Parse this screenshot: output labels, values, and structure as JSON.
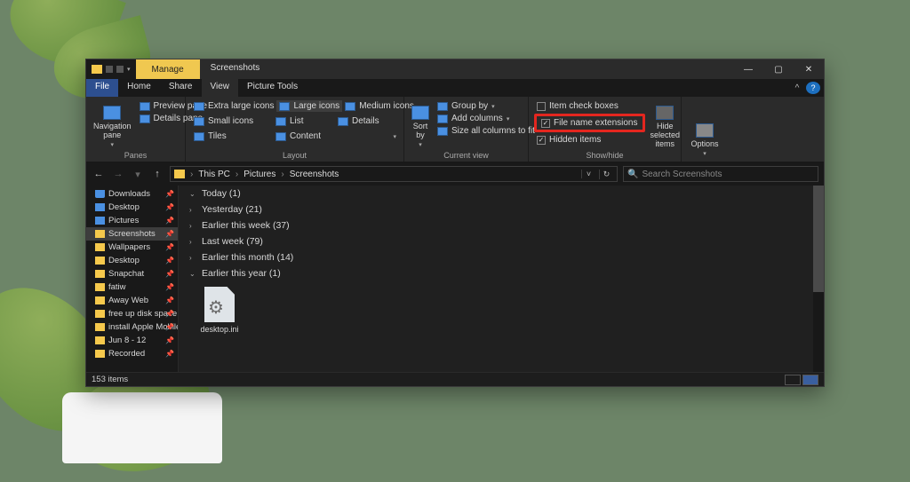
{
  "titlebar": {
    "context_tab": "Manage",
    "title": "Screenshots"
  },
  "menubar": {
    "file": "File",
    "tabs": [
      "Home",
      "Share",
      "View"
    ],
    "active_index": 2,
    "context_tool": "Picture Tools"
  },
  "ribbon": {
    "panes": {
      "label": "Panes",
      "nav": "Navigation pane",
      "preview": "Preview pane",
      "details": "Details pane"
    },
    "layout": {
      "label": "Layout",
      "items": [
        "Extra large icons",
        "Large icons",
        "Medium icons",
        "Small icons",
        "List",
        "Details",
        "Tiles",
        "Content"
      ],
      "selected_index": 1
    },
    "current_view": {
      "label": "Current view",
      "sort": "Sort by",
      "group": "Group by",
      "add_cols": "Add columns",
      "size_cols": "Size all columns to fit"
    },
    "showhide": {
      "label": "Show/hide",
      "item_check": "Item check boxes",
      "ext": "File name extensions",
      "hidden": "Hidden items",
      "hide_sel": "Hide selected items",
      "item_check_checked": false,
      "ext_checked": true,
      "hidden_checked": true
    },
    "options": "Options"
  },
  "address": {
    "crumbs": [
      "This PC",
      "Pictures",
      "Screenshots"
    ]
  },
  "search": {
    "placeholder": "Search Screenshots"
  },
  "tree": [
    {
      "label": "Downloads",
      "pinned": true,
      "kind": "dl"
    },
    {
      "label": "Desktop",
      "pinned": true,
      "kind": "blue"
    },
    {
      "label": "Pictures",
      "pinned": true,
      "kind": "blue"
    },
    {
      "label": "Screenshots",
      "pinned": true,
      "kind": "folder",
      "active": true
    },
    {
      "label": "Wallpapers",
      "pinned": true,
      "kind": "folder"
    },
    {
      "label": "Desktop",
      "pinned": true,
      "kind": "folder"
    },
    {
      "label": "Snapchat",
      "pinned": true,
      "kind": "folder"
    },
    {
      "label": "fatiw",
      "pinned": true,
      "kind": "folder"
    },
    {
      "label": "Away Web",
      "pinned": true,
      "kind": "folder"
    },
    {
      "label": "free up disk space",
      "pinned": true,
      "kind": "folder"
    },
    {
      "label": "install Apple Mobile",
      "pinned": true,
      "kind": "folder"
    },
    {
      "label": "Jun 8 - 12",
      "pinned": true,
      "kind": "folder"
    },
    {
      "label": "Recorded",
      "pinned": true,
      "kind": "folder"
    }
  ],
  "groups": [
    {
      "label": "Today (1)",
      "expanded": true
    },
    {
      "label": "Yesterday (21)",
      "expanded": false
    },
    {
      "label": "Earlier this week (37)",
      "expanded": false
    },
    {
      "label": "Last week (79)",
      "expanded": false
    },
    {
      "label": "Earlier this month (14)",
      "expanded": false
    },
    {
      "label": "Earlier this year (1)",
      "expanded": true
    }
  ],
  "visible_file": {
    "name": "desktop.ini"
  },
  "status": {
    "items": "153 items"
  }
}
